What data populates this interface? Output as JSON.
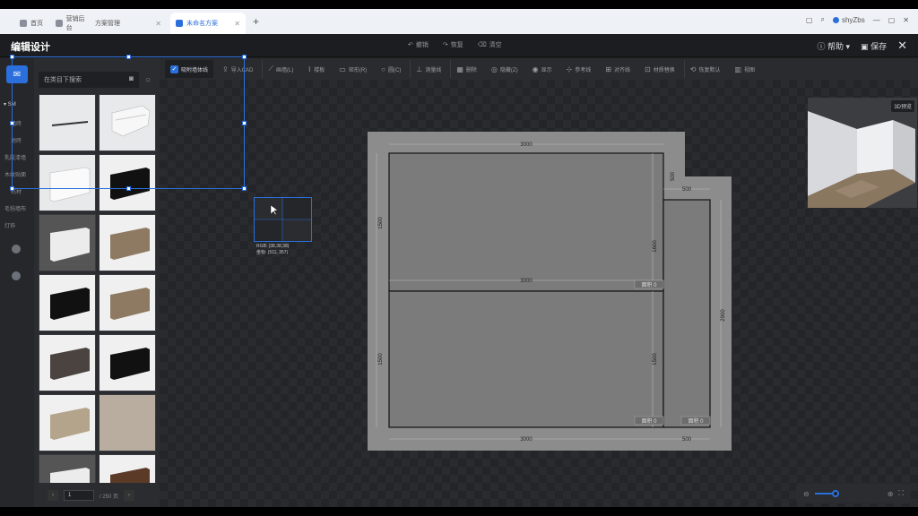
{
  "browser": {
    "tabs": [
      {
        "label": "首页"
      },
      {
        "label": "营销后台"
      },
      {
        "label": "方案管理"
      },
      {
        "label": "未命名方案",
        "active": true
      }
    ],
    "plus": "+",
    "profile": "shyZbs"
  },
  "app": {
    "title": "编辑设计",
    "undo": "撤销",
    "redo": "恢复",
    "clear": "清空",
    "help": "帮助",
    "save": "保存"
  },
  "toolbar": [
    {
      "label": "吸附墙体线",
      "icon": "checkbox-icon"
    },
    {
      "label": "导入CAD",
      "icon": "upload-icon"
    },
    {
      "label": "画墙(L)",
      "icon": "wall-icon"
    },
    {
      "label": "楼板",
      "icon": "floor-icon"
    },
    {
      "label": "矩形(R)",
      "icon": "rect-icon"
    },
    {
      "label": "圆(C)",
      "icon": "circle-icon"
    },
    {
      "label": "测量线",
      "icon": "measure-icon"
    },
    {
      "label": "删除",
      "icon": "delete-icon"
    },
    {
      "label": "隐藏(Z)",
      "icon": "hide-icon"
    },
    {
      "label": "显示",
      "icon": "eye-icon"
    },
    {
      "label": "参考线",
      "icon": "guide-icon"
    },
    {
      "label": "对齐线",
      "icon": "align-icon"
    },
    {
      "label": "材质替换",
      "icon": "material-icon"
    },
    {
      "label": "恢复默认",
      "icon": "reset-icon"
    },
    {
      "label": "视图",
      "icon": "view-icon"
    }
  ],
  "rail": {
    "section": "SM",
    "items": [
      "墙砖",
      "地砖",
      "乳胶漆墙",
      "木纹贴面",
      "石材",
      "毛毡墙布",
      "灯饰"
    ]
  },
  "catalog": {
    "search_placeholder": "在类目下搜索",
    "page_value": "1",
    "page_total": "/ 250 页",
    "tiles": [
      {
        "kind": "thin-line"
      },
      {
        "kind": "crown-molding"
      },
      {
        "kind": "white-baseboard"
      },
      {
        "kind": "black-baseboard"
      },
      {
        "kind": "gray-baseboard"
      },
      {
        "kind": "wood-baseboard"
      },
      {
        "kind": "black-baseboard"
      },
      {
        "kind": "wood-baseboard"
      },
      {
        "kind": "dark-wood-baseboard"
      },
      {
        "kind": "black-baseboard"
      },
      {
        "kind": "light-wood-baseboard"
      },
      {
        "kind": "stone-texture"
      },
      {
        "kind": "gray-baseboard"
      },
      {
        "kind": "walnut-baseboard"
      }
    ]
  },
  "plan": {
    "dims": {
      "top": "3000",
      "notch_v": "500",
      "notch_h": "500",
      "left_upper": "1500",
      "left_lower": "1500",
      "mid_v": "1600",
      "mid_h": "3000",
      "lower_v": "1500",
      "right_v": "2900",
      "bottom": "3000",
      "bottom_right": "500"
    },
    "areas": [
      "0",
      "0",
      "0"
    ],
    "area_prefix": "面积"
  },
  "preview": {
    "button": "3D预览"
  },
  "picker": {
    "rgb": "RGB: (38,38,38)",
    "pos": "坐标: (511, 357)"
  },
  "colors": {
    "accent": "#2a6fdb"
  }
}
